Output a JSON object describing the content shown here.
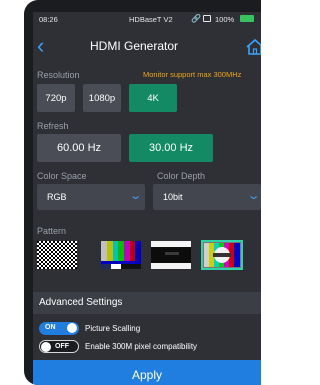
{
  "status": {
    "time": "08:26",
    "device": "HDBaseT V2",
    "battery": "100%"
  },
  "header": {
    "title": "HDMI Generator"
  },
  "resolution": {
    "label": "Resolution",
    "note": "Monitor support max 300MHz",
    "options": [
      "720p",
      "1080p",
      "4K"
    ],
    "selected": "4K"
  },
  "refresh": {
    "label": "Refresh",
    "options": [
      "60.00 Hz",
      "30.00 Hz"
    ],
    "selected": "30.00 Hz"
  },
  "color_space": {
    "label": "Color Space",
    "value": "RGB"
  },
  "color_depth": {
    "label": "Color Depth",
    "value": "10bit"
  },
  "pattern": {
    "label": "Pattern",
    "items": [
      {
        "name": "checkerboard",
        "brand": ""
      },
      {
        "name": "color-bars",
        "brand": ""
      },
      {
        "name": "gray-bars",
        "brand": "Baluntech"
      },
      {
        "name": "color-bars-logo",
        "brand": "Baluntech"
      }
    ],
    "selected_index": 3
  },
  "advanced": {
    "title": "Advanced Settings",
    "options": [
      {
        "label": "Picture Scalling",
        "state": "ON"
      },
      {
        "label": "Enable 300M pixel compatibility",
        "state": "OFF"
      }
    ]
  },
  "apply_label": "Apply",
  "colors": {
    "accent": "#1f7ee0",
    "selected": "#138a64",
    "warning": "#f0a51a",
    "background": "#2e3036"
  }
}
